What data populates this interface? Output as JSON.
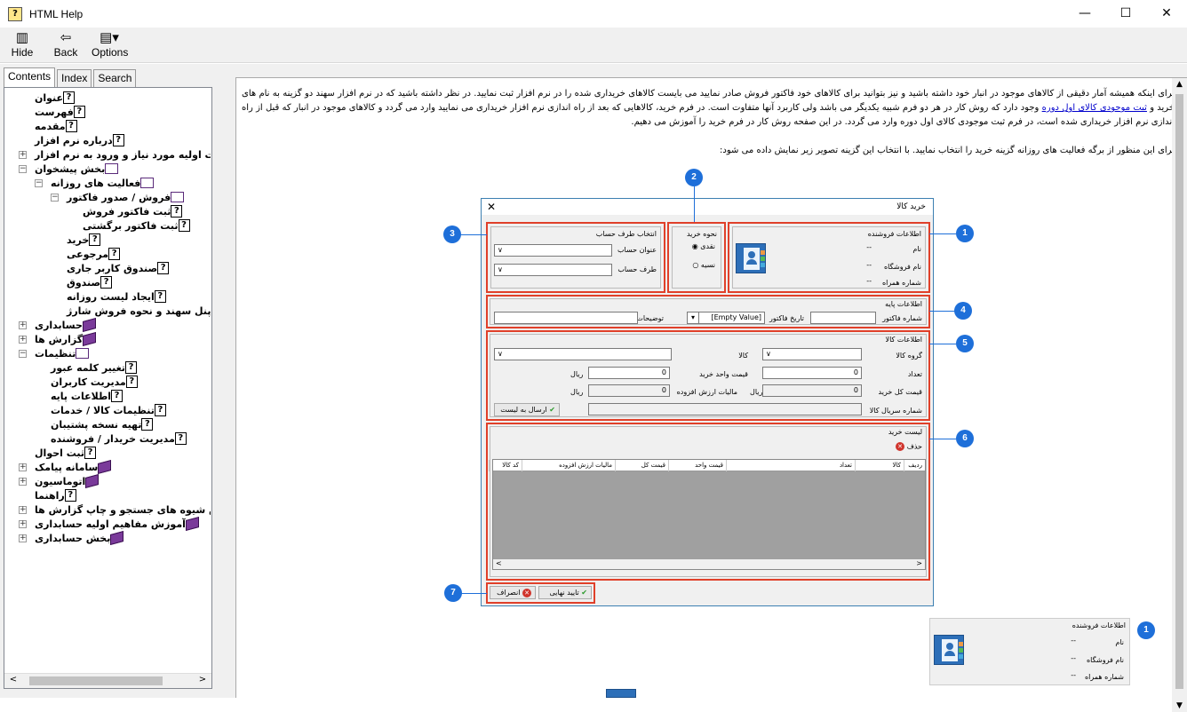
{
  "window": {
    "title": "HTML Help",
    "app_icon": "help-book-icon",
    "minimize": "—",
    "maximize": "☐",
    "close": "✕"
  },
  "toolbar": {
    "hide_label": "Hide",
    "back_label": "Back",
    "options_label": "Options"
  },
  "nav": {
    "tabs": [
      "Contents",
      "Index",
      "Search"
    ],
    "tree": [
      {
        "label": "عنوان",
        "icon": "topic"
      },
      {
        "label": "فهرست",
        "icon": "topic"
      },
      {
        "label": "مقدمه",
        "icon": "topic"
      },
      {
        "label": "درباره نرم افزار",
        "icon": "topic"
      },
      {
        "label": "اطلاعات اولیه مورد نیاز و ورود به نرم افزار",
        "icon": "book"
      },
      {
        "label": "بخش پیشخوان",
        "icon": "open-book"
      },
      {
        "label": "فعالیت های روزانه",
        "icon": "open-book"
      },
      {
        "label": "فروش / صدور فاکتور",
        "icon": "open-book"
      },
      {
        "label": "ثبت فاکتور فروش",
        "icon": "topic"
      },
      {
        "label": "ثبت فاکتور برگشتی",
        "icon": "topic"
      },
      {
        "label": "خرید",
        "icon": "topic"
      },
      {
        "label": "مرجوعی",
        "icon": "topic"
      },
      {
        "label": "صندوق کاربر جاری",
        "icon": "topic"
      },
      {
        "label": "صندوق",
        "icon": "topic"
      },
      {
        "label": "ایجاد لیست روزانه",
        "icon": "topic"
      },
      {
        "label": "معرفی پنل سهند و نحوه فروش شارژ",
        "icon": "topic"
      },
      {
        "label": "حسابداری",
        "icon": "book"
      },
      {
        "label": "گزارش ها",
        "icon": "book"
      },
      {
        "label": "تنظیمات",
        "icon": "open-book"
      },
      {
        "label": "تغییر کلمه عبور",
        "icon": "topic"
      },
      {
        "label": "مدیریت کاربران",
        "icon": "topic"
      },
      {
        "label": "اطلاعات پایه",
        "icon": "topic"
      },
      {
        "label": "تنظیمات کالا / خدمات",
        "icon": "topic"
      },
      {
        "label": "تهیه نسخه پشتیبان",
        "icon": "topic"
      },
      {
        "label": "مدیریت خریدار / فروشنده",
        "icon": "topic"
      },
      {
        "label": "ثبت احوال",
        "icon": "topic"
      },
      {
        "label": "سامانه پیامک",
        "icon": "book"
      },
      {
        "label": "اتوماسیون",
        "icon": "book"
      },
      {
        "label": "راهنما",
        "icon": "topic"
      },
      {
        "label": "آموزش شیوه های جستجو و چاپ گزارش ها",
        "icon": "book"
      },
      {
        "label": "آموزش مفاهیم اولیه حسابداری",
        "icon": "book"
      },
      {
        "label": "بخش حسابداری",
        "icon": "book"
      }
    ]
  },
  "article": {
    "p1_a": "برای اینکه همیشه آمار دقیقی از کالاهای موجود در انبار خود داشته باشید و نیز بتوانید برای کالاهای خود فاکتور فروش صادر نمایید می بایست کالاهای خریداری شده را در نرم افزار ثبت نمایید. در نظر داشته باشید که در نرم افزار سهند دو گزینه به نام های خرید و",
    "p1_link": "ثبت موجودی کالای اول دوره",
    "p1_b": "وجود دارد که روش کار در هر دو فرم شبیه یکدیگر می باشد ولی کاربرد آنها متفاوت است. در فرم خرید، کالاهایی که بعد از راه اندازی نرم افزار خریداری می نمایید وارد می گردد و کالاهای موجود در انبار که قبل از راه اندازی نرم افزار خریداری شده است، در فرم ثبت موجودی کالای اول دوره وارد می گردد. در این صفحه روش کار در فرم خرید را آموزش می دهیم.",
    "p2": "برای این منظور از برگه فعالیت های روزانه گزینه خرید را انتخاب نمایید. با انتخاب این گزینه تصویر زیر نمایش داده می شود:"
  },
  "dialog": {
    "title": "خرید کالا",
    "seller": {
      "title": "اطلاعات فروشنده",
      "name_label": "نام",
      "name_value": "--",
      "shop_label": "نام فروشگاه",
      "shop_value": "--",
      "mobile_label": "شماره همراه",
      "mobile_value": "--"
    },
    "purchase_type": {
      "title": "نحوه خرید",
      "cash": "نقدی",
      "credit": "نسیه"
    },
    "account": {
      "title": "انتخاب طرف حساب",
      "account_title_label": "عنوان حساب",
      "party_label": "طرف حساب"
    },
    "base": {
      "title": "اطلاعات پایه",
      "invoice_no_label": "شماره فاکتور",
      "invoice_date_label": "تاریخ فاکتور",
      "date_value": "[Empty Value]",
      "desc_label": "توضیحات"
    },
    "goods": {
      "title": "اطلاعات کالا",
      "group_label": "گروه کالا",
      "item_label": "کالا",
      "qty_label": "تعداد",
      "qty_value": "0",
      "unit_price_label": "قیمت واحد خرید",
      "unit_price_value": "0",
      "currency": "ریال",
      "total_label": "قیمت کل خرید",
      "total_value": "0",
      "vat_label": "مالیات ارزش افزوده",
      "vat_value": "0",
      "serial_label": "شماره سریال کالا",
      "send_button": "ارسال به لیست"
    },
    "list": {
      "title": "لیست خرید",
      "delete_button": "حذف",
      "columns": [
        "ردیف",
        "کالا",
        "تعداد",
        "قیمت واحد",
        "قیمت کل",
        "مالیات ارزش افزوده",
        "کد کالا"
      ]
    },
    "confirm_button": "تایید نهایی",
    "cancel_button": "انصراف"
  },
  "badges": [
    "1",
    "2",
    "3",
    "4",
    "5",
    "6",
    "7"
  ],
  "mini_seller": {
    "title": "اطلاعات فروشنده",
    "name_label": "نام",
    "name_value": "--",
    "shop_label": "نام فروشگاه",
    "shop_value": "--",
    "mobile_label": "شماره همراه",
    "mobile_value": "--",
    "badge": "1"
  },
  "colors": {
    "badge": "#1e6fd9",
    "highlight": "#e0402a",
    "link": "#0000cc"
  }
}
